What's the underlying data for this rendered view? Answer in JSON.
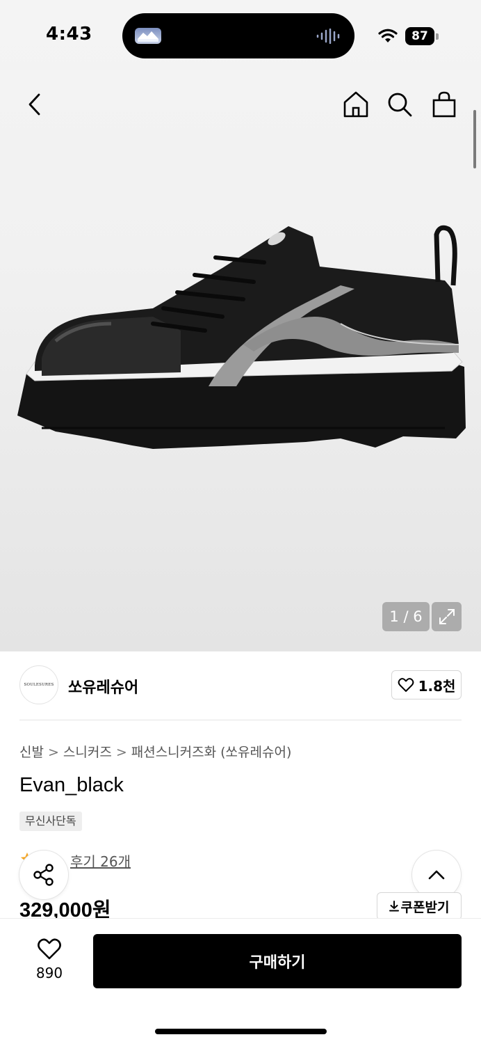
{
  "status_bar": {
    "time": "4:43",
    "battery": "87",
    "icons": [
      "wifi-icon",
      "battery-icon",
      "audio-wave-icon"
    ]
  },
  "nav": {
    "icons": [
      "back-arrow-icon",
      "home-icon",
      "search-icon",
      "shopping-bag-icon"
    ]
  },
  "gallery": {
    "counter": "1 / 6",
    "expand_icon": "expand-icon"
  },
  "brand": {
    "logo_text": "SOULESURES",
    "name": "쏘유레슈어",
    "like_count": "1.8천"
  },
  "breadcrumb": {
    "items": [
      "신발",
      "스니커즈",
      "패션스니커즈화 (쏘유레슈어)"
    ]
  },
  "product": {
    "title": "Evan_black",
    "tag": "무신사단독",
    "review_link": "후기 26개",
    "price": "329,000원",
    "coupon_label": "쿠폰받기"
  },
  "bottom_bar": {
    "wish_count": "890",
    "buy_label": "구매하기"
  },
  "colors": {
    "background": "#ffffff",
    "hero_background": "#f1f1f1",
    "primary_button": "#000000",
    "text_secondary": "#555555",
    "rating_star": "#f5a623"
  }
}
